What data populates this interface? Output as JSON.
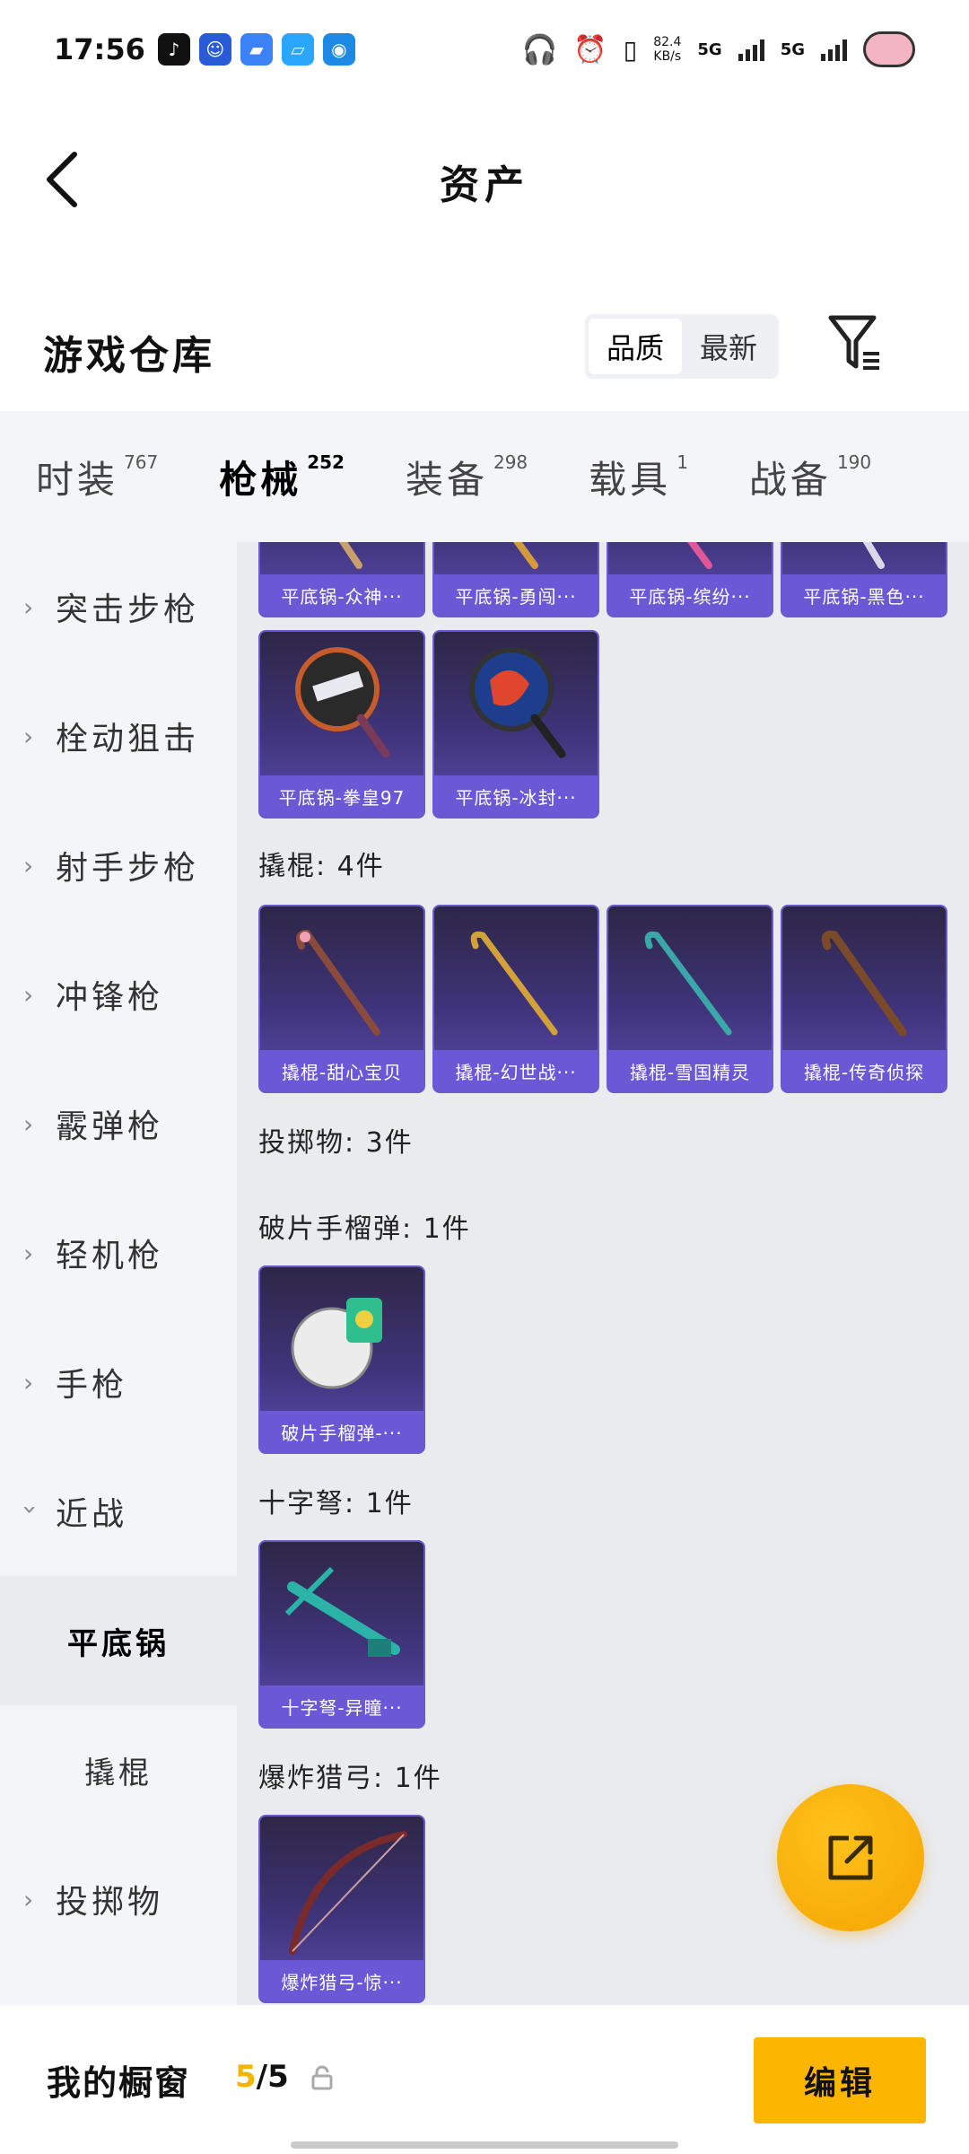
{
  "status_bar": {
    "time": "17:56",
    "speed_value": "82.4",
    "speed_unit": "KB/s",
    "net1": "5G",
    "net2": "5G"
  },
  "header": {
    "title": "资产"
  },
  "warehouse": {
    "title": "游戏仓库",
    "sort_options": [
      "品质",
      "最新"
    ]
  },
  "tabs": [
    {
      "label": "时装",
      "count": "767"
    },
    {
      "label": "枪械",
      "count": "252"
    },
    {
      "label": "装备",
      "count": "298"
    },
    {
      "label": "载具",
      "count": "1"
    },
    {
      "label": "战备",
      "count": "190"
    }
  ],
  "categories": {
    "assault_rifle": "突击步枪",
    "bolt_sniper": "栓动狙击",
    "marksman_rifle": "射手步枪",
    "smg": "冲锋枪",
    "shotgun": "霰弹枪",
    "lmg": "轻机枪",
    "pistol": "手枪",
    "melee": "近战",
    "pan": "平底锅",
    "crowbar": "撬棍",
    "throwable": "投掷物"
  },
  "sections": {
    "crowbar_title": "撬棍: 4件",
    "throwable_title": "投掷物: 3件",
    "frag_title": "破片手榴弹: 1件",
    "crossbow_title": "十字弩: 1件",
    "bow_title": "爆炸猎弓: 1件"
  },
  "items": {
    "pan_row1": [
      "平底锅-众神···",
      "平底锅-勇闯···",
      "平底锅-缤纷···",
      "平底锅-黑色···"
    ],
    "pan_row2": [
      "平底锅-拳皇97",
      "平底锅-冰封···"
    ],
    "crowbars": [
      "撬棍-甜心宝贝",
      "撬棍-幻世战···",
      "撬棍-雪国精灵",
      "撬棍-传奇侦探"
    ],
    "frag": "破片手榴弹-···",
    "crossbow": "十字弩-异瞳···",
    "bow": "爆炸猎弓-惊···"
  },
  "bottom": {
    "title": "我的橱窗",
    "count_current": "5",
    "count_total": "/5",
    "edit": "编辑"
  }
}
